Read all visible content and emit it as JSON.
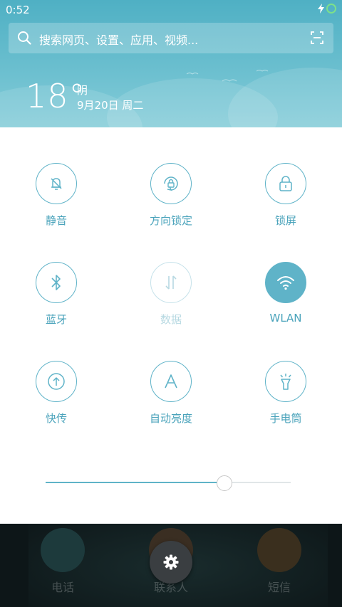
{
  "status_bar": {
    "time": "0:52",
    "icons": [
      "charging-icon",
      "battery-icon"
    ]
  },
  "search": {
    "placeholder": "搜索网页、设置、应用、视频..."
  },
  "weather": {
    "temperature": "18°",
    "condition": "阴",
    "date": "9月20日 周二"
  },
  "toggles": [
    {
      "label": "静音",
      "icon": "silent-bell-icon",
      "state": "off"
    },
    {
      "label": "方向锁定",
      "icon": "rotation-lock-icon",
      "state": "off"
    },
    {
      "label": "锁屏",
      "icon": "lock-icon",
      "state": "off"
    },
    {
      "label": "蓝牙",
      "icon": "bluetooth-icon",
      "state": "off"
    },
    {
      "label": "数据",
      "icon": "data-arrows-icon",
      "state": "disabled"
    },
    {
      "label": "WLAN",
      "icon": "wifi-icon",
      "state": "on"
    },
    {
      "label": "快传",
      "icon": "quick-transfer-icon",
      "state": "off"
    },
    {
      "label": "自动亮度",
      "icon": "auto-brightness-icon",
      "state": "off"
    },
    {
      "label": "手电筒",
      "icon": "flashlight-icon",
      "state": "off"
    }
  ],
  "brightness": {
    "value": 0.73
  },
  "dock": [
    {
      "label": "电话",
      "icon": "phone-icon"
    },
    {
      "label": "联系人",
      "icon": "contacts-icon"
    },
    {
      "label": "短信",
      "icon": "messages-icon"
    }
  ],
  "colors": {
    "accent": "#5fb3c8",
    "header": "#5db8c9",
    "wlan_active": "#5fb3c8"
  }
}
